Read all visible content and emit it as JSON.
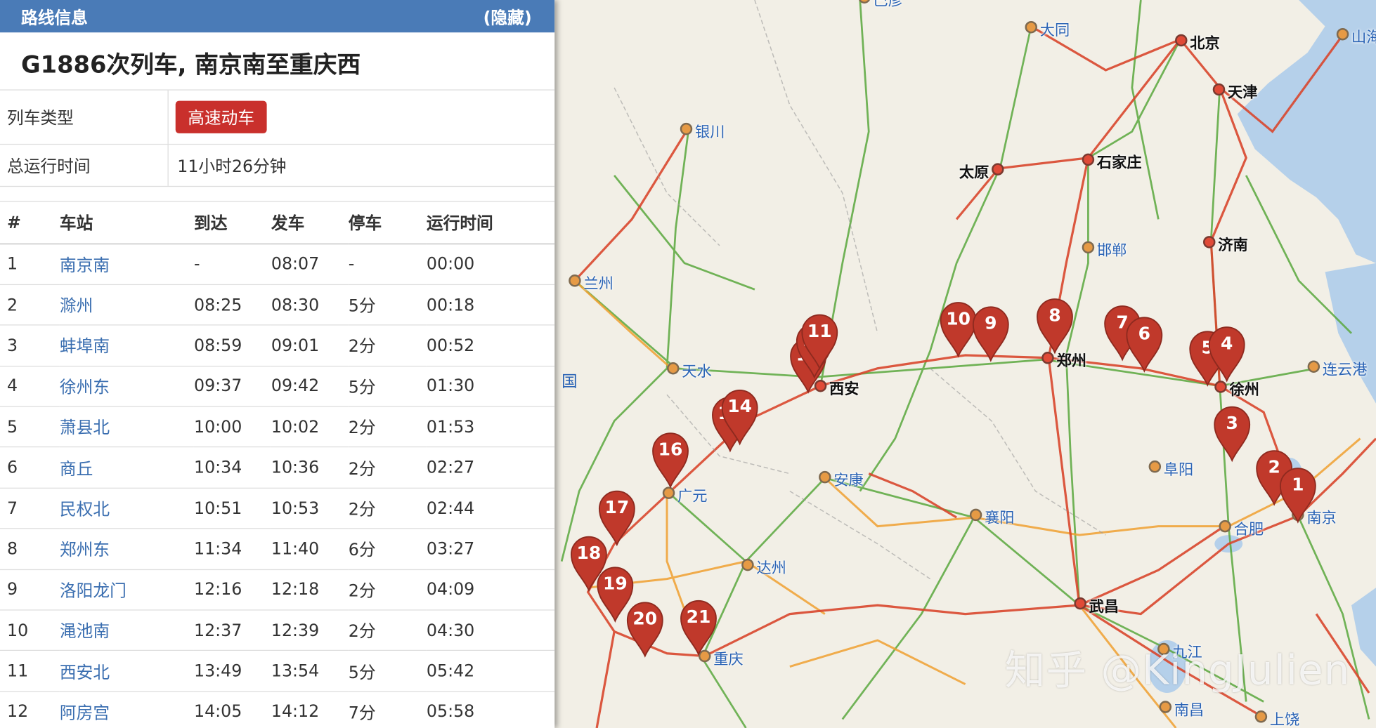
{
  "panel": {
    "header_title": "路线信息",
    "hide_label": "(隐藏)",
    "route_title": "G1886次列车, 南京南至重庆西",
    "train_type_label": "列车类型",
    "train_type_value": "高速动车",
    "total_time_label": "总运行时间",
    "total_time_value": "11小时26分钟",
    "columns": [
      "#",
      "车站",
      "到达",
      "发车",
      "停车",
      "运行时间"
    ],
    "rows": [
      [
        "1",
        "南京南",
        "-",
        "08:07",
        "-",
        "00:00"
      ],
      [
        "2",
        "滁州",
        "08:25",
        "08:30",
        "5分",
        "00:18"
      ],
      [
        "3",
        "蚌埠南",
        "08:59",
        "09:01",
        "2分",
        "00:52"
      ],
      [
        "4",
        "徐州东",
        "09:37",
        "09:42",
        "5分",
        "01:30"
      ],
      [
        "5",
        "萧县北",
        "10:00",
        "10:02",
        "2分",
        "01:53"
      ],
      [
        "6",
        "商丘",
        "10:34",
        "10:36",
        "2分",
        "02:27"
      ],
      [
        "7",
        "民权北",
        "10:51",
        "10:53",
        "2分",
        "02:44"
      ],
      [
        "8",
        "郑州东",
        "11:34",
        "11:40",
        "6分",
        "03:27"
      ],
      [
        "9",
        "洛阳龙门",
        "12:16",
        "12:18",
        "2分",
        "04:09"
      ],
      [
        "10",
        "渑池南",
        "12:37",
        "12:39",
        "2分",
        "04:30"
      ],
      [
        "11",
        "西安北",
        "13:49",
        "13:54",
        "5分",
        "05:42"
      ],
      [
        "12",
        "阿房宫",
        "14:05",
        "14:12",
        "7分",
        "05:58"
      ]
    ]
  },
  "map": {
    "cities": [
      {
        "name": "大同",
        "type": "minor"
      },
      {
        "name": "北京",
        "type": "major"
      },
      {
        "name": "天津",
        "type": "major"
      },
      {
        "name": "银川",
        "type": "minor"
      },
      {
        "name": "太原",
        "type": "major"
      },
      {
        "name": "石家庄",
        "type": "major"
      },
      {
        "name": "邯郸",
        "type": "minor"
      },
      {
        "name": "济南",
        "type": "major"
      },
      {
        "name": "兰州",
        "type": "minor"
      },
      {
        "name": "郑州",
        "type": "major"
      },
      {
        "name": "天水",
        "type": "minor"
      },
      {
        "name": "西安",
        "type": "major"
      },
      {
        "name": "徐州",
        "type": "major"
      },
      {
        "name": "连云港",
        "type": "minor"
      },
      {
        "name": "阜阳",
        "type": "minor"
      },
      {
        "name": "安康",
        "type": "minor"
      },
      {
        "name": "广元",
        "type": "minor"
      },
      {
        "name": "南京",
        "type": "minor"
      },
      {
        "name": "合肥",
        "type": "minor"
      },
      {
        "name": "襄阳",
        "type": "minor"
      },
      {
        "name": "达州",
        "type": "minor"
      },
      {
        "name": "武昌",
        "type": "major"
      },
      {
        "name": "重庆",
        "type": "minor"
      },
      {
        "name": "九江",
        "type": "minor"
      },
      {
        "name": "南昌",
        "type": "minor"
      },
      {
        "name": "上饶",
        "type": "minor"
      },
      {
        "name": "山海",
        "type": "minor"
      },
      {
        "name": "巴彦",
        "type": "minor"
      }
    ],
    "pins": [
      "1",
      "2",
      "3",
      "4",
      "5",
      "6",
      "7",
      "8",
      "9",
      "10",
      "11",
      "12",
      "13",
      "14",
      "15",
      "16",
      "17",
      "18",
      "19",
      "20",
      "21"
    ],
    "edge_text": "国",
    "watermark": "知乎 @KingJulien",
    "colors": {
      "pin": "#c0392b",
      "rail_red": "#d9472e",
      "rail_green": "#5aa83e",
      "rail_orange": "#f0a030",
      "water": "#b5d0ea",
      "land": "#f2efe6"
    }
  }
}
